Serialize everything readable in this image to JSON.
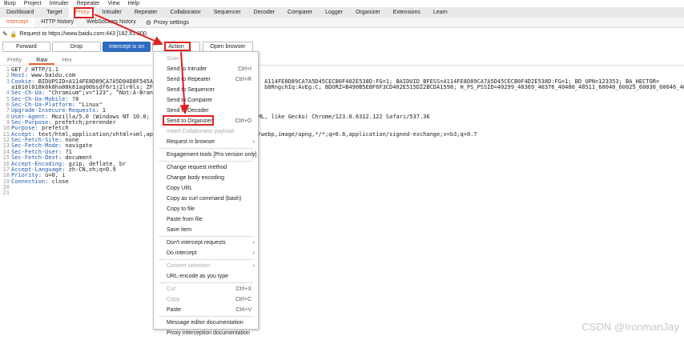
{
  "menubar": [
    "Burp",
    "Project",
    "Intruder",
    "Repeater",
    "View",
    "Help"
  ],
  "tabs": [
    "Dashboard",
    "Target",
    "Proxy",
    "Intruder",
    "Repeater",
    "Collaborator",
    "Sequencer",
    "Decoder",
    "Comparer",
    "Logger",
    "Organizer",
    "Extensions",
    "Learn"
  ],
  "subtabs": [
    "Intercept",
    "HTTP history",
    "WebSockets history"
  ],
  "proxy_settings": "Proxy settings",
  "request_line": "Request to https://www.baidu.com:443  [182.61.200.",
  "buttons": {
    "forward": "Forward",
    "drop": "Drop",
    "intercept": "Intercept is on",
    "action": "Action",
    "open_browser": "Open browser"
  },
  "viewtabs": [
    "Pretty",
    "Raw",
    "Hex"
  ],
  "editor_lines": [
    {
      "n": "1",
      "k": "",
      "v": "GET / HTTP/1.1"
    },
    {
      "n": "2",
      "k": "Host: ",
      "v": "www.baidu.com"
    },
    {
      "n": "3",
      "k": "Cookie: ",
      "v": "BIDUPSID=A114FE8D89CA7A5D04D8F545AE                                A114FE8D89CA7A5D45CECB0F402E538D:FG=1; BAIDUID_BFESS=A114FE8D89CA7A5D45CECB0F4D2E538D:FG=1; BD_UPN=123353; BA_HECTOR="
    },
    {
      "n": "",
      "k": "",
      "v": "a1010l018k6k8ha08k81ag00bsdf6r1j2lr0ls; ZF                                 b8RngchIq:AvEg:C; BDORZ=B490B5EBF6F3CD402E515D22BCDA1598; H_PS_PSSID=40299_40369_40376_40480_40511_60040_60025_60030_60046_40080"
    },
    {
      "n": "4",
      "k": "Sec-Ch-Ua: ",
      "v": "\"Chromium\";v=\"123\", \"Not:A-Brand"
    },
    {
      "n": "5",
      "k": "Sec-Ch-Ua-Mobile: ",
      "v": "?0"
    },
    {
      "n": "6",
      "k": "Sec-Ch-Ua-Platform: ",
      "v": "\"Linux\""
    },
    {
      "n": "7",
      "k": "Upgrade-Insecure-Requests: ",
      "v": "1"
    },
    {
      "n": "8",
      "k": "User-Agent: ",
      "v": "Mozilla/5.0 (Windows NT 10.0; Wi                         (KHTML, like Gecko) Chrome/123.0.6312.122 Safari/537.36"
    },
    {
      "n": "9",
      "k": "Sec-Purpose: ",
      "v": "prefetch;prerender"
    },
    {
      "n": "10",
      "k": "Purpose: ",
      "v": "prefetch"
    },
    {
      "n": "11",
      "k": "Accept: ",
      "v": "text/html,application/xhtml+xml,app                         image/webp,image/apng,*/*;q=0.8,application/signed-exchange;v=b3;q=0.7"
    },
    {
      "n": "12",
      "k": "Sec-Fetch-Site: ",
      "v": "none"
    },
    {
      "n": "13",
      "k": "Sec-Fetch-Mode: ",
      "v": "navigate"
    },
    {
      "n": "14",
      "k": "Sec-Fetch-User: ",
      "v": "?1"
    },
    {
      "n": "15",
      "k": "Sec-Fetch-Dest: ",
      "v": "document"
    },
    {
      "n": "16",
      "k": "Accept-Encoding: ",
      "v": "gzip, deflate, br"
    },
    {
      "n": "17",
      "k": "Accept-Language: ",
      "v": "zh-CN,zh;q=0.9"
    },
    {
      "n": "18",
      "k": "Priority: ",
      "v": "u=0, i"
    },
    {
      "n": "19",
      "k": "Connection: ",
      "v": "close"
    },
    {
      "n": "20",
      "k": "",
      "v": ""
    },
    {
      "n": "21",
      "k": "",
      "v": ""
    }
  ],
  "context_menu": [
    {
      "label": "Scan",
      "shortcut": "",
      "disabled": true,
      "submenu": false
    },
    {
      "label": "Send to Intruder",
      "shortcut": "Ctrl+I",
      "disabled": false,
      "submenu": false
    },
    {
      "label": "Send to Repeater",
      "shortcut": "Ctrl+R",
      "disabled": false,
      "submenu": false
    },
    {
      "label": "Send to Sequencer",
      "shortcut": "",
      "disabled": false,
      "submenu": false
    },
    {
      "label": "Send to Comparer",
      "shortcut": "",
      "disabled": false,
      "submenu": false
    },
    {
      "label": "Send to Decoder",
      "shortcut": "",
      "disabled": false,
      "submenu": false
    },
    {
      "label": "Send to Organizer",
      "shortcut": "Ctrl+O",
      "disabled": false,
      "submenu": false
    },
    {
      "label": "Insert Collaborator payload",
      "shortcut": "",
      "disabled": true,
      "submenu": false
    },
    {
      "label": "Request in browser",
      "shortcut": "",
      "disabled": false,
      "submenu": true
    },
    {
      "sep": true
    },
    {
      "label": "Engagement tools [Pro version only]",
      "shortcut": "",
      "disabled": false,
      "submenu": true
    },
    {
      "sep": true
    },
    {
      "label": "Change request method",
      "shortcut": "",
      "disabled": false,
      "submenu": false
    },
    {
      "label": "Change body encoding",
      "shortcut": "",
      "disabled": false,
      "submenu": false
    },
    {
      "label": "Copy URL",
      "shortcut": "",
      "disabled": false,
      "submenu": false
    },
    {
      "label": "Copy as curl command (bash)",
      "shortcut": "",
      "disabled": false,
      "submenu": false
    },
    {
      "label": "Copy to file",
      "shortcut": "",
      "disabled": false,
      "submenu": false
    },
    {
      "label": "Paste from file",
      "shortcut": "",
      "disabled": false,
      "submenu": false
    },
    {
      "label": "Save item",
      "shortcut": "",
      "disabled": false,
      "submenu": false
    },
    {
      "sep": true
    },
    {
      "label": "Don't intercept requests",
      "shortcut": "",
      "disabled": false,
      "submenu": true
    },
    {
      "label": "Do intercept",
      "shortcut": "",
      "disabled": false,
      "submenu": true
    },
    {
      "sep": true
    },
    {
      "label": "Convert selection",
      "shortcut": "",
      "disabled": true,
      "submenu": true
    },
    {
      "label": "URL-encode as you type",
      "shortcut": "",
      "disabled": false,
      "submenu": false
    },
    {
      "sep": true
    },
    {
      "label": "Cut",
      "shortcut": "Ctrl+X",
      "disabled": true,
      "submenu": false
    },
    {
      "label": "Copy",
      "shortcut": "Ctrl+C",
      "disabled": true,
      "submenu": false
    },
    {
      "label": "Paste",
      "shortcut": "Ctrl+V",
      "disabled": false,
      "submenu": false
    },
    {
      "sep": true
    },
    {
      "label": "Message editor documentation",
      "shortcut": "",
      "disabled": false,
      "submenu": false
    },
    {
      "label": "Proxy interception documentation",
      "shortcut": "",
      "disabled": false,
      "submenu": false
    }
  ],
  "watermark": "CSDN @IronmanJay",
  "colors": {
    "accent": "#e8672a",
    "highlight": "#e02020",
    "intercept_on": "#2e6cbf"
  }
}
